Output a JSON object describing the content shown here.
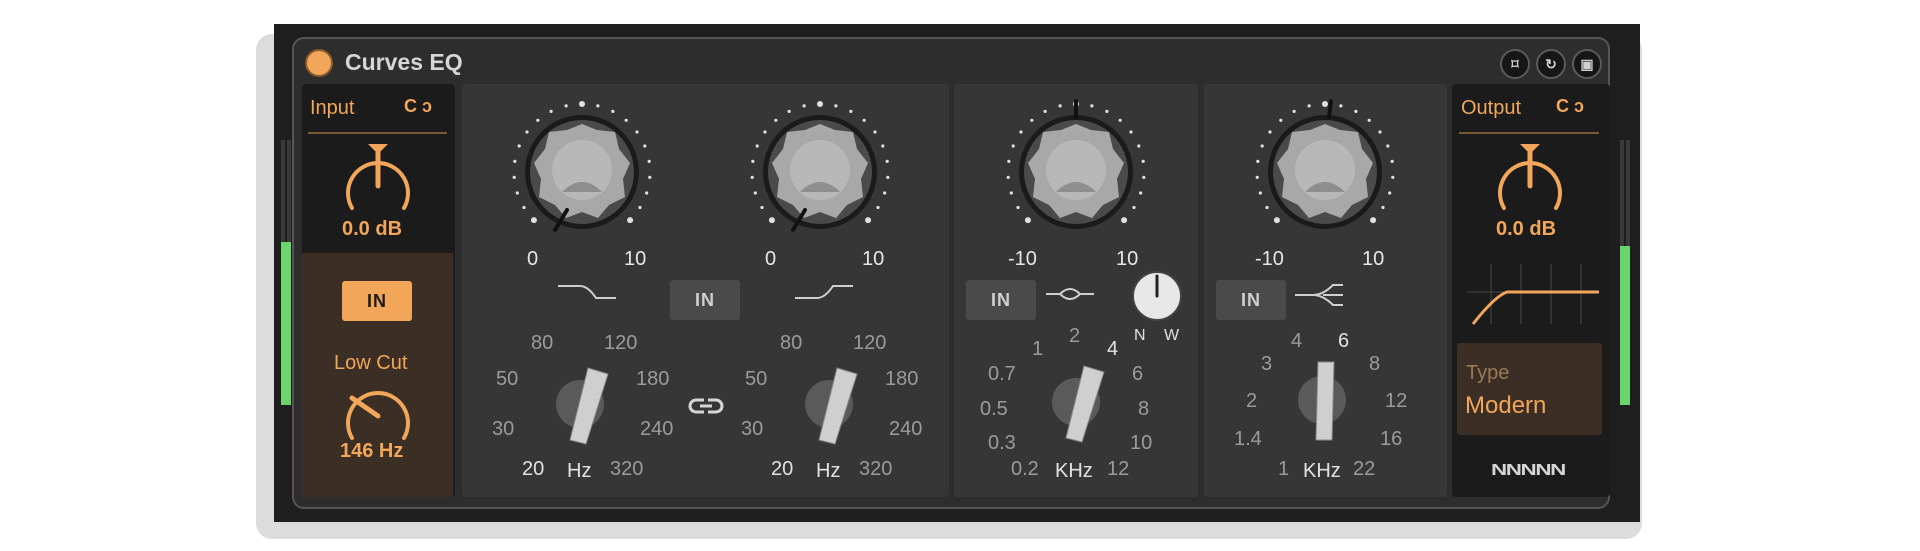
{
  "device": {
    "title": "Curves EQ",
    "header_buttons": [
      "fold-icon",
      "hot-swap-icon",
      "save-icon"
    ]
  },
  "input": {
    "label": "Input",
    "value": "0.0 dB",
    "in_button": "IN",
    "lowcut_label": "Low Cut",
    "lowcut_value": "146 Hz"
  },
  "bands": [
    {
      "knob_scale": [
        "0",
        "10"
      ],
      "freq_ticks": [
        "80",
        "120",
        "50",
        "180",
        "30",
        "240",
        "20",
        "320"
      ],
      "unit": "Hz"
    },
    {
      "knob_scale": [
        "0",
        "10"
      ],
      "freq_ticks": [
        "80",
        "120",
        "50",
        "180",
        "30",
        "240",
        "20",
        "320"
      ],
      "unit": "Hz",
      "in_button": "IN"
    },
    {
      "knob_scale": [
        "-10",
        "10"
      ],
      "in_button": "IN",
      "q_labels": [
        "N",
        "W"
      ],
      "freq_ticks": [
        "1",
        "2",
        "4",
        "0.7",
        "6",
        "0.5",
        "8",
        "0.3",
        "10",
        "0.2",
        "12"
      ],
      "unit": "KHz"
    },
    {
      "knob_scale": [
        "-10",
        "10"
      ],
      "in_button": "IN",
      "freq_ticks": [
        "4",
        "6",
        "3",
        "8",
        "2",
        "12",
        "1.4",
        "16",
        "1",
        "22"
      ],
      "unit": "KHz"
    }
  ],
  "output": {
    "label": "Output",
    "value": "0.0 dB",
    "type_label": "Type",
    "type_value": "Modern",
    "logo": "NNNNN"
  },
  "colors": {
    "accent": "#f2a65a",
    "panel": "#363636",
    "side": "#1b1b1b",
    "meter": "#6cd46c"
  }
}
